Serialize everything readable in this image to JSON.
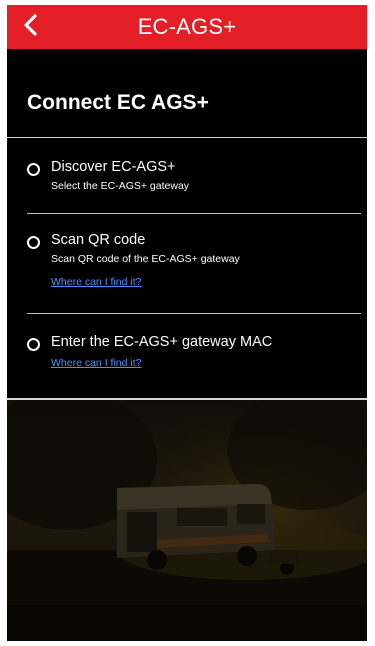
{
  "header": {
    "title": "EC-AGS+",
    "back_icon": "chevron-left-icon",
    "color": "#e31e26"
  },
  "page": {
    "title": "Connect EC AGS+"
  },
  "options": [
    {
      "title": "Discover EC-AGS+",
      "subtitle": "Select the EC-AGS+ gateway"
    },
    {
      "title": "Scan QR code",
      "subtitle": "Scan QR code of the EC-AGS+ gateway",
      "link": "Where can I find it?"
    },
    {
      "title": "Enter the EC-AGS+ gateway MAC",
      "link": "Where can I find it?"
    }
  ],
  "background": {
    "image": "dark campground photo with RV motorhome"
  }
}
